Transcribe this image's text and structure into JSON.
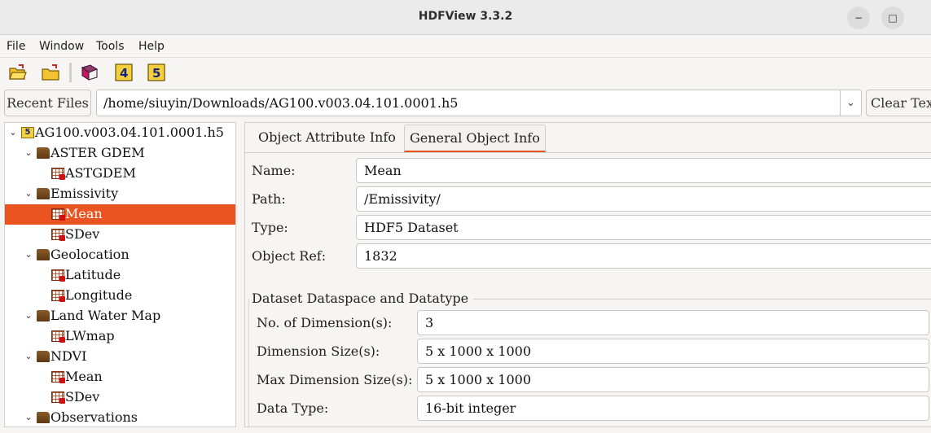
{
  "window": {
    "title": "HDFView 3.3.2",
    "minimize_icon": "minimize-icon",
    "maximize_icon": "maximize-icon",
    "minimize_glyph": "−",
    "maximize_glyph": "□"
  },
  "menu": {
    "items": [
      "File",
      "Window",
      "Tools",
      "Help"
    ]
  },
  "toolbar": {
    "buttons": [
      "open-file-icon",
      "open-folder-icon",
      "user-guide-icon",
      "hdf4-library-icon",
      "hdf5-library-icon"
    ],
    "hdf4_glyph": "4",
    "hdf5_glyph": "5"
  },
  "pathbar": {
    "recent_label": "Recent Files",
    "path": "/home/siuyin/Downloads/AG100.v003.04.101.0001.h5",
    "dropdown_glyph": "⌄",
    "clear_label": "Clear Tex"
  },
  "tree": {
    "root": "AG100.v003.04.101.0001.h5",
    "expand_glyph": "⌄",
    "nodes": [
      {
        "label": "ASTER GDEM",
        "kind": "group"
      },
      {
        "label": "ASTGDEM",
        "kind": "dataset"
      },
      {
        "label": "Emissivity",
        "kind": "group"
      },
      {
        "label": "Mean",
        "kind": "dataset",
        "selected": true
      },
      {
        "label": "SDev",
        "kind": "dataset"
      },
      {
        "label": "Geolocation",
        "kind": "group"
      },
      {
        "label": "Latitude",
        "kind": "dataset"
      },
      {
        "label": "Longitude",
        "kind": "dataset"
      },
      {
        "label": "Land Water Map",
        "kind": "group"
      },
      {
        "label": "LWmap",
        "kind": "dataset"
      },
      {
        "label": "NDVI",
        "kind": "group"
      },
      {
        "label": "Mean",
        "kind": "dataset"
      },
      {
        "label": "SDev",
        "kind": "dataset"
      },
      {
        "label": "Observations",
        "kind": "group"
      }
    ]
  },
  "tabs": {
    "attribute": "Object Attribute Info",
    "general": "General Object Info"
  },
  "general": {
    "name_label": "Name:",
    "name_value": "Mean",
    "path_label": "Path:",
    "path_value": "/Emissivity/",
    "type_label": "Type:",
    "type_value": "HDF5 Dataset",
    "ref_label": "Object Ref:",
    "ref_value": "1832"
  },
  "dataspace": {
    "title": "Dataset Dataspace and Datatype",
    "ndims_label": "No. of Dimension(s):",
    "ndims_value": "3",
    "dims_label": "Dimension Size(s):",
    "dims_value": "5 x 1000 x 1000",
    "maxdims_label": "Max Dimension Size(s):",
    "maxdims_value": "5 x 1000 x 1000",
    "dtype_label": "Data Type:",
    "dtype_value": "16-bit integer"
  },
  "colors": {
    "accent": "#e95420",
    "selection_text": "#ffffff"
  }
}
